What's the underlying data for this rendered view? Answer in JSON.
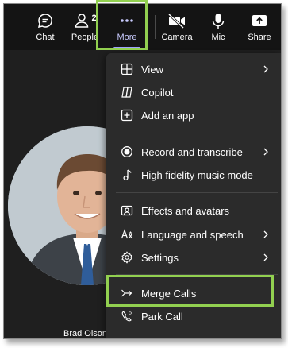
{
  "toolbar": {
    "chat_label": "Chat",
    "people_label": "People",
    "people_count": "2",
    "more_label": "More",
    "camera_label": "Camera",
    "mic_label": "Mic",
    "share_label": "Share"
  },
  "participant": {
    "name": "Brad Olson"
  },
  "menu": {
    "items": [
      {
        "label": "View",
        "icon": "grid-icon",
        "submenu": true
      },
      {
        "label": "Copilot",
        "icon": "copilot-icon",
        "submenu": false
      },
      {
        "label": "Add an app",
        "icon": "plus-box-icon",
        "submenu": false
      },
      {
        "label": "Record and transcribe",
        "icon": "record-icon",
        "submenu": true
      },
      {
        "label": "High fidelity music mode",
        "icon": "music-note-icon",
        "submenu": false
      },
      {
        "label": "Effects and avatars",
        "icon": "effects-icon",
        "submenu": false
      },
      {
        "label": "Language and speech",
        "icon": "language-icon",
        "submenu": true
      },
      {
        "label": "Settings",
        "icon": "gear-icon",
        "submenu": true
      },
      {
        "label": "Merge Calls",
        "icon": "merge-icon",
        "submenu": false
      },
      {
        "label": "Park Call",
        "icon": "park-call-icon",
        "submenu": false
      }
    ]
  },
  "colors": {
    "highlight": "#92d050",
    "accent": "#9ea2ff",
    "menu_bg": "#2b2b2b",
    "toolbar_bg": "#141414"
  }
}
